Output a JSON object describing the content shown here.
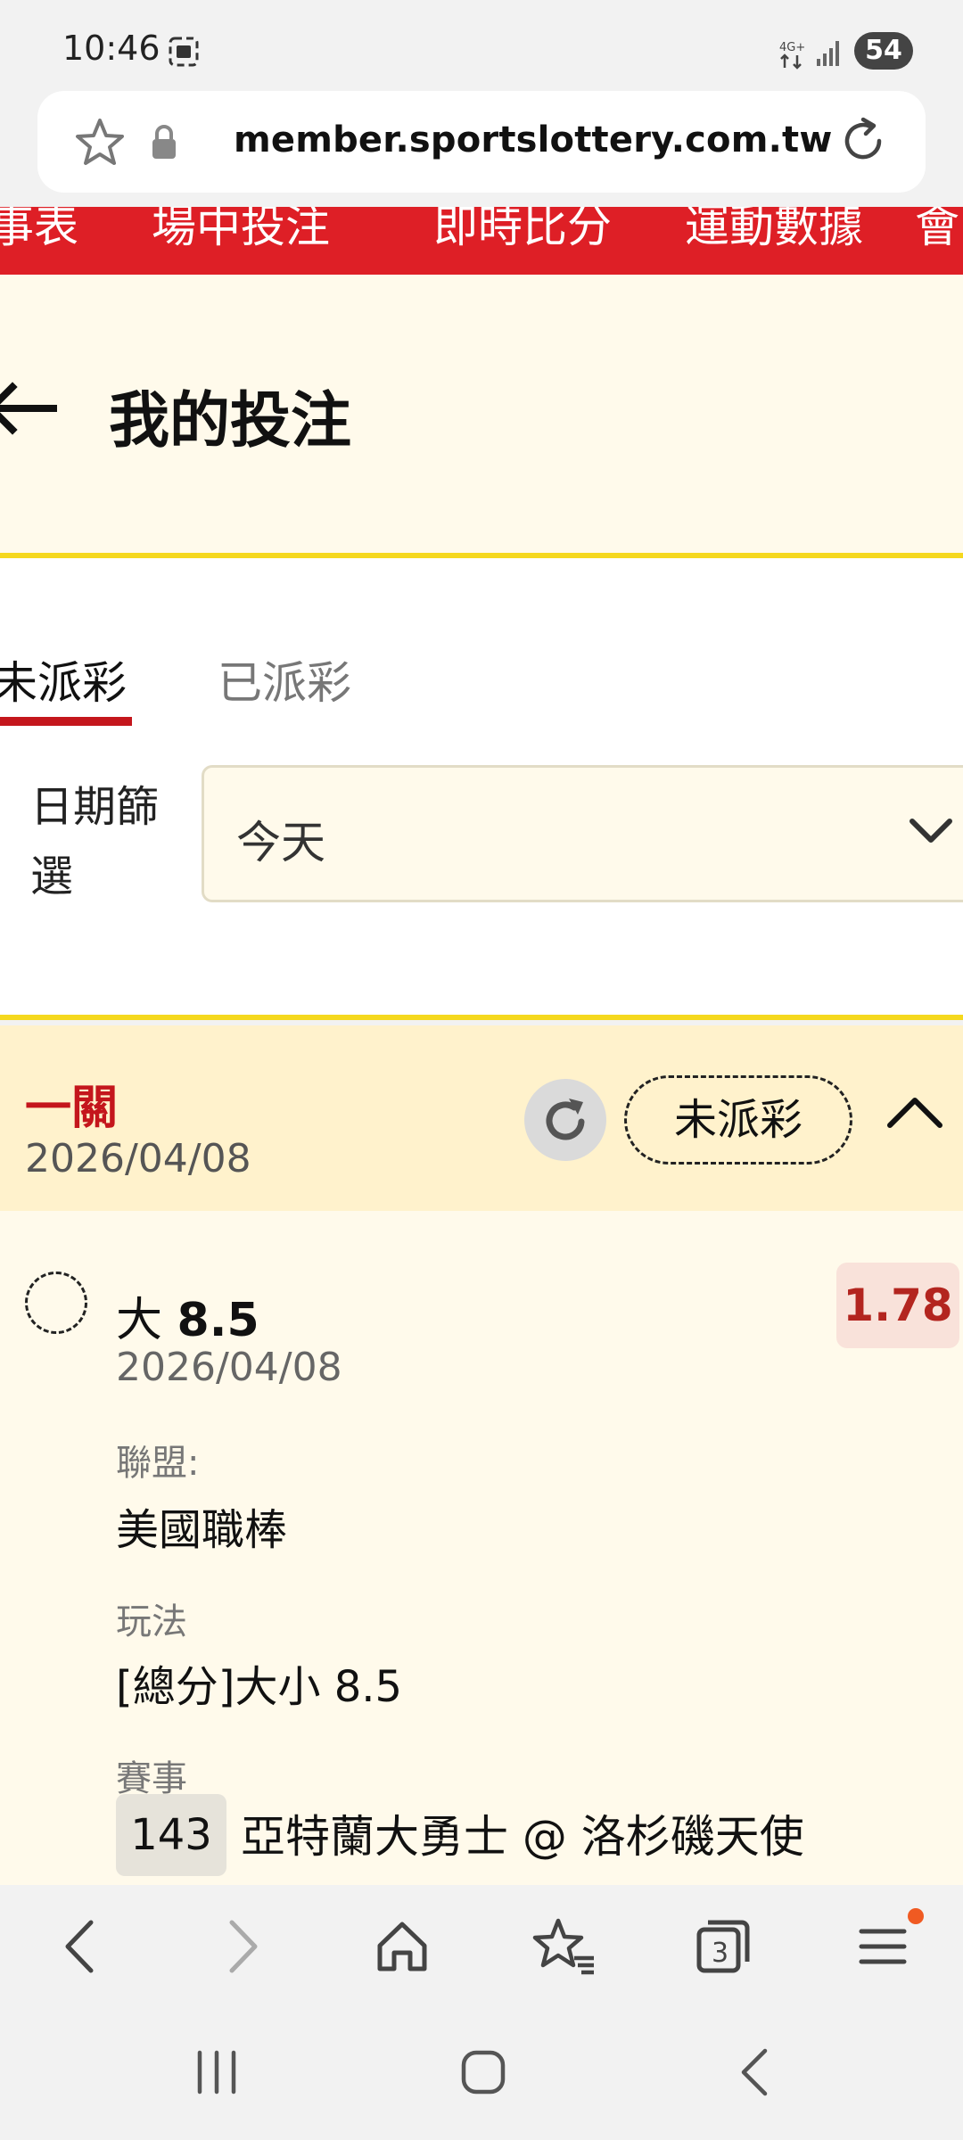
{
  "status_bar": {
    "time": "10:46",
    "network": "4G+",
    "battery": "54"
  },
  "browser": {
    "url": "member.sportslottery.com.tw",
    "tab_count": "3"
  },
  "top_nav": {
    "items": [
      {
        "label": "賽事表"
      },
      {
        "label": "場中投注"
      },
      {
        "label": "即時比分"
      },
      {
        "label": "運動數據"
      },
      {
        "label": "會"
      }
    ]
  },
  "header": {
    "title": "我的投注"
  },
  "tabs": [
    {
      "label": "未派彩",
      "active": true
    },
    {
      "label": "已派彩",
      "active": false
    }
  ],
  "filter": {
    "label": "日期篩選",
    "value": "今天"
  },
  "bet_group": {
    "type": "一關",
    "date": "2026/04/08",
    "status": "未派彩",
    "bet": {
      "selection_prefix": "大",
      "selection_value": "8.5",
      "odds": "1.78",
      "date": "2026/04/08",
      "league_label": "聯盟:",
      "league_value": "美國職棒",
      "market_label": "玩法",
      "market_value": "[總分]大小 8.5",
      "event_label": "賽事",
      "event_number": "143",
      "event_name": "亞特蘭大勇士 @ 洛杉磯天使"
    }
  },
  "colors": {
    "brand_red": "#de1f26",
    "accent_yellow": "#f5d81e",
    "odds_red": "#b3251f"
  }
}
